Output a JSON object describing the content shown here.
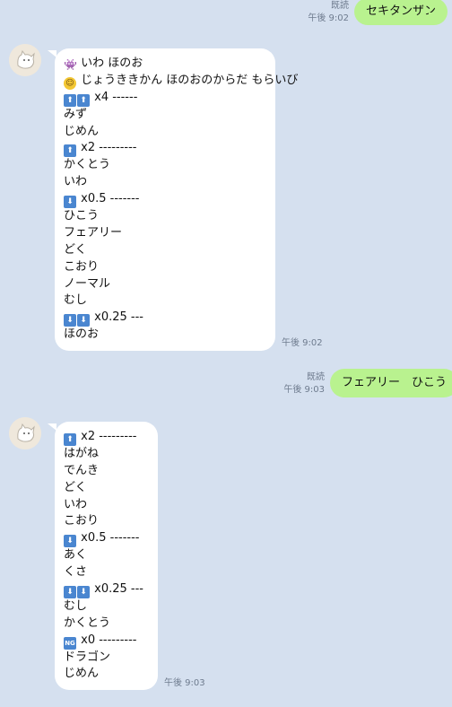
{
  "messages": {
    "m1": {
      "read": "既読",
      "time": "午後 9:02",
      "text": "セキタンザン"
    },
    "m2": {
      "time": "午後 9:02",
      "lines": [
        {
          "icons": [
            "alien"
          ],
          "text": "いわ ほのお"
        },
        {
          "icons": [
            "face"
          ],
          "text": "じょうききかん ほのおのからだ もらいび"
        },
        {
          "icons": [
            "up",
            "up"
          ],
          "text": "x4 ------"
        },
        {
          "icons": [],
          "text": "みず"
        },
        {
          "icons": [],
          "text": "じめん"
        },
        {
          "icons": [
            "up"
          ],
          "text": "x2 ---------"
        },
        {
          "icons": [],
          "text": "かくとう"
        },
        {
          "icons": [],
          "text": "いわ"
        },
        {
          "icons": [
            "down"
          ],
          "text": "x0.5 -------"
        },
        {
          "icons": [],
          "text": "ひこう"
        },
        {
          "icons": [],
          "text": "フェアリー"
        },
        {
          "icons": [],
          "text": "どく"
        },
        {
          "icons": [],
          "text": "こおり"
        },
        {
          "icons": [],
          "text": "ノーマル"
        },
        {
          "icons": [],
          "text": "むし"
        },
        {
          "icons": [
            "down",
            "down"
          ],
          "text": "x0.25 ---"
        },
        {
          "icons": [],
          "text": "ほのお"
        }
      ]
    },
    "m3": {
      "read": "既読",
      "time": "午後 9:03",
      "text": "フェアリー　ひこう"
    },
    "m4": {
      "time": "午後 9:03",
      "lines": [
        {
          "icons": [
            "up"
          ],
          "text": "x2 ---------"
        },
        {
          "icons": [],
          "text": "はがね"
        },
        {
          "icons": [],
          "text": "でんき"
        },
        {
          "icons": [],
          "text": "どく"
        },
        {
          "icons": [],
          "text": "いわ"
        },
        {
          "icons": [],
          "text": "こおり"
        },
        {
          "icons": [
            "down"
          ],
          "text": "x0.5 -------"
        },
        {
          "icons": [],
          "text": "あく"
        },
        {
          "icons": [],
          "text": "くさ"
        },
        {
          "icons": [
            "down",
            "down"
          ],
          "text": "x0.25 ---"
        },
        {
          "icons": [],
          "text": "むし"
        },
        {
          "icons": [],
          "text": "かくとう"
        },
        {
          "icons": [
            "ng"
          ],
          "text": "x0 ---------"
        },
        {
          "icons": [],
          "text": "ドラゴン"
        },
        {
          "icons": [],
          "text": "じめん"
        }
      ]
    }
  },
  "icon_glyphs": {
    "up": "⬆",
    "down": "⬇",
    "ng": "NG",
    "face": "☺",
    "alien": "👾"
  },
  "colors": {
    "background": "#d5e0ef",
    "outgoing_bubble": "#b9f28f",
    "incoming_bubble": "#ffffff",
    "meta_text": "#6e7b8e"
  }
}
